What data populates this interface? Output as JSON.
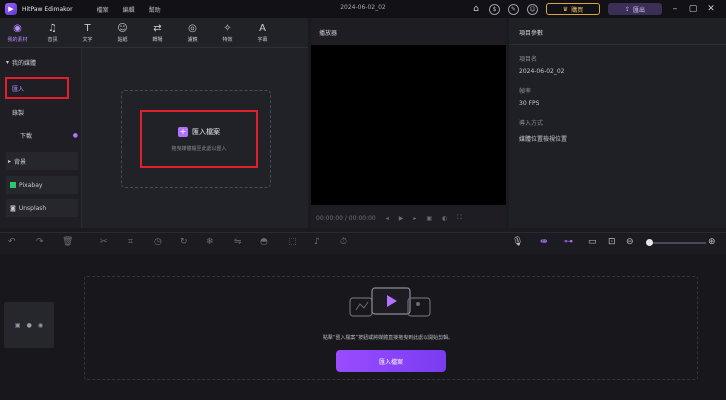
{
  "titlebar": {
    "app_name": "HitPaw Edimakor",
    "menu": [
      "檔案",
      "編輯",
      "幫助"
    ],
    "filename": "2024-06-02_02",
    "upgrade_label": "購買",
    "export_label": "匯出"
  },
  "tabs": [
    {
      "label": "我的素材",
      "icon": "folder-icon",
      "active": true
    },
    {
      "label": "音訊",
      "icon": "music-icon"
    },
    {
      "label": "文字",
      "icon": "text-icon"
    },
    {
      "label": "貼紙",
      "icon": "sticker-icon"
    },
    {
      "label": "轉場",
      "icon": "transition-icon"
    },
    {
      "label": "濾鏡",
      "icon": "filter-icon"
    },
    {
      "label": "特效",
      "icon": "effect-icon"
    },
    {
      "label": "字幕",
      "icon": "subtitle-icon"
    }
  ],
  "sidebar": {
    "section_mine": "我的媒體",
    "import": "匯入",
    "record": "錄製",
    "download": "下載",
    "section_bg": "背景",
    "pixabay": "Pixabay",
    "unsplash": "Unsplash"
  },
  "import_box": {
    "title": "匯入檔案",
    "subtitle": "拖曳媒體檔至此處以匯入"
  },
  "player": {
    "title": "播放器",
    "time": "00:00:00 / 00:00:00"
  },
  "properties": {
    "title": "項目參數",
    "name_label": "項目名",
    "name_value": "2024-06-02_02",
    "fps_label": "幀率",
    "fps_value": "30 FPS",
    "location_label": "導入方式",
    "location_value": "媒體位置檢視位置"
  },
  "timeline": {
    "hint": "點擊“匯入檔案”按鈕或將媒體直接拖曳到此處以開始剪輯。",
    "import_button": "匯入檔案"
  }
}
